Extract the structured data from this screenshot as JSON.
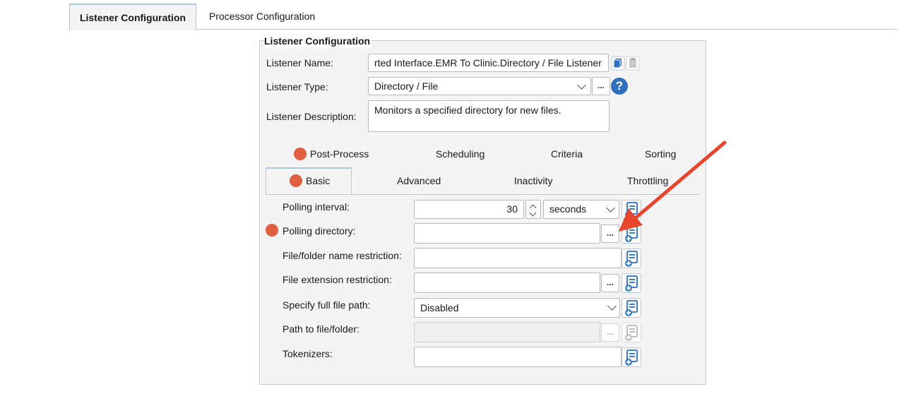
{
  "tabs": [
    {
      "label": "Listener Configuration",
      "active": true
    },
    {
      "label": "Processor Configuration",
      "active": false
    }
  ],
  "group": {
    "title": "Listener Configuration",
    "listener_name_label": "Listener Name:",
    "listener_name_value": "rted Interface.EMR To Clinic.Directory / File Listener",
    "listener_type_label": "Listener Type:",
    "listener_type_value": "Directory / File",
    "listener_description_label": "Listener Description:",
    "listener_description_value": "Monitors a specified directory for new files.",
    "browse_label": "...",
    "help_label": "?"
  },
  "subtabs": {
    "row1": [
      "Post-Process",
      "Scheduling",
      "Criteria",
      "Sorting"
    ],
    "row2": [
      "Basic",
      "Advanced",
      "Inactivity",
      "Throttling"
    ]
  },
  "basic": {
    "polling_interval_label": "Polling interval:",
    "polling_interval_value": "30",
    "polling_interval_unit": "seconds",
    "polling_directory_label": "Polling directory:",
    "polling_directory_value": "",
    "name_restriction_label": "File/folder name restriction:",
    "extension_restriction_label": "File extension restriction:",
    "full_path_label": "Specify full file path:",
    "full_path_value": "Disabled",
    "path_label": "Path to file/folder:",
    "tokenizers_label": "Tokenizers:",
    "browse_label": "..."
  },
  "colors": {
    "required_dot": "#e0603f",
    "annotation_arrow": "#e8452c",
    "help_icon": "#2f6fbd",
    "variable_icon": "#3b7fd1"
  }
}
